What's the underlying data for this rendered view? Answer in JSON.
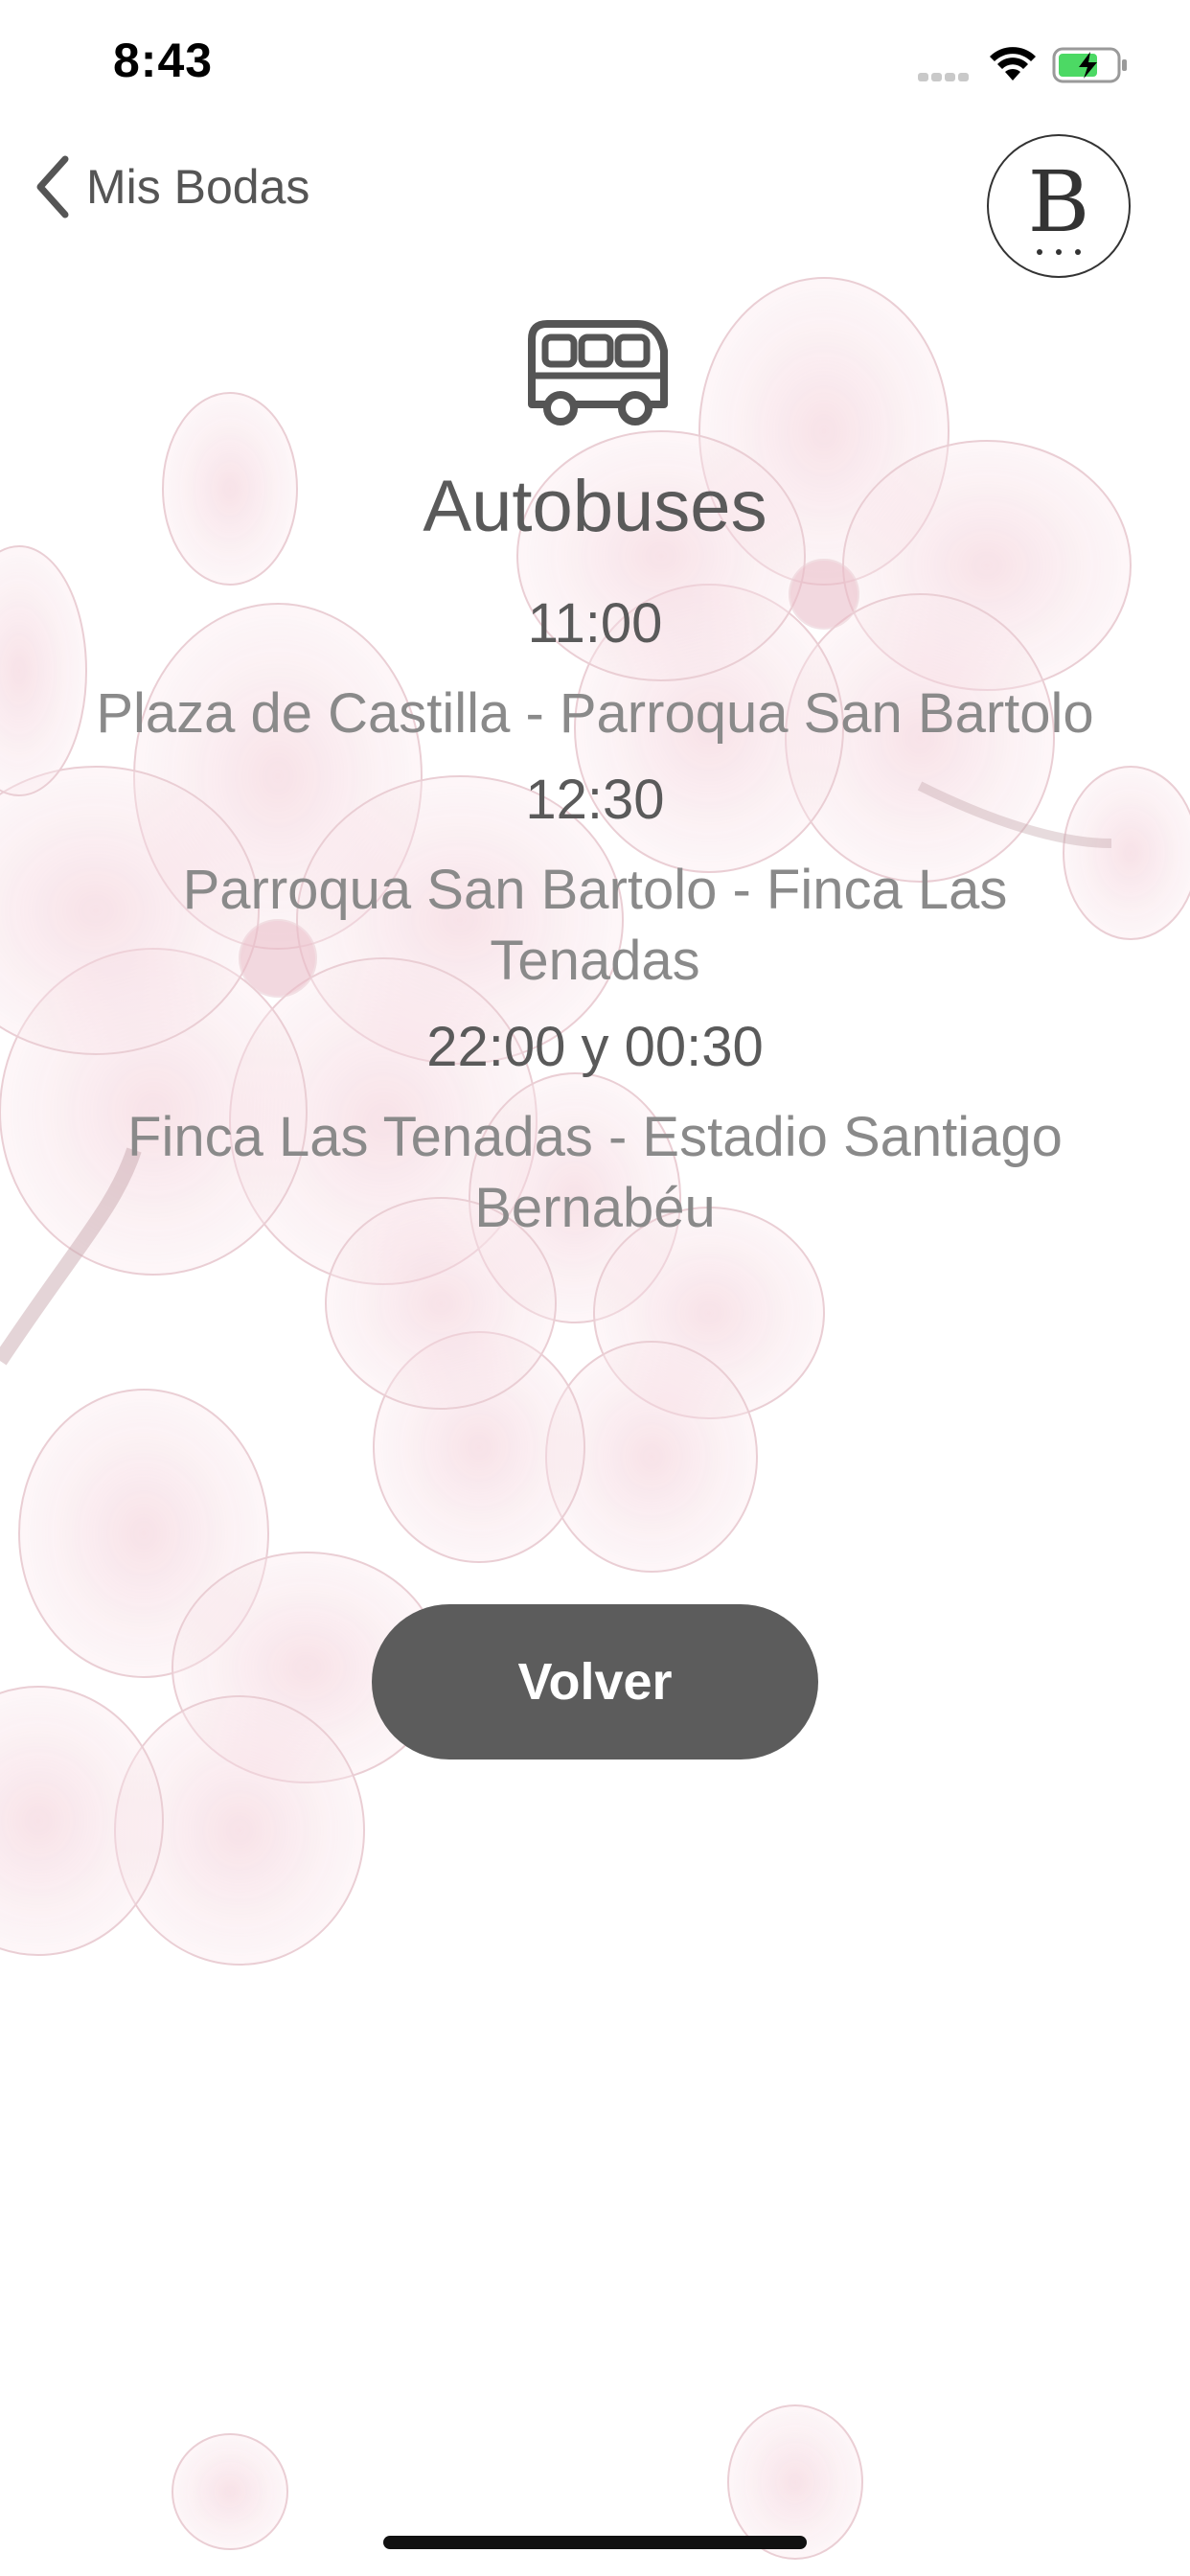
{
  "status_bar": {
    "time": "8:43",
    "icons": [
      "signal-icon",
      "wifi-icon",
      "battery-charging-icon"
    ]
  },
  "nav": {
    "back_label": "Mis Bodas",
    "back_icon": "chevron-left-icon",
    "logo_letter": "B"
  },
  "header": {
    "icon": "bus-icon",
    "title": "Autobuses"
  },
  "schedule": [
    {
      "time": "11:00",
      "route": "Plaza de Castilla -  Parroqua San Bartolo"
    },
    {
      "time": "12:30",
      "route": "Parroqua San Bartolo -  Finca Las Tenadas"
    },
    {
      "time": "22:00 y 00:30",
      "route": "Finca Las Tenadas - Estadio Santiago Bernabéu"
    }
  ],
  "actions": {
    "back_button_label": "Volver"
  },
  "colors": {
    "text": "#555555",
    "route_text": "#8a8a8a",
    "button_bg": "#5c5c5c",
    "blossom": "#f3d4dc"
  }
}
